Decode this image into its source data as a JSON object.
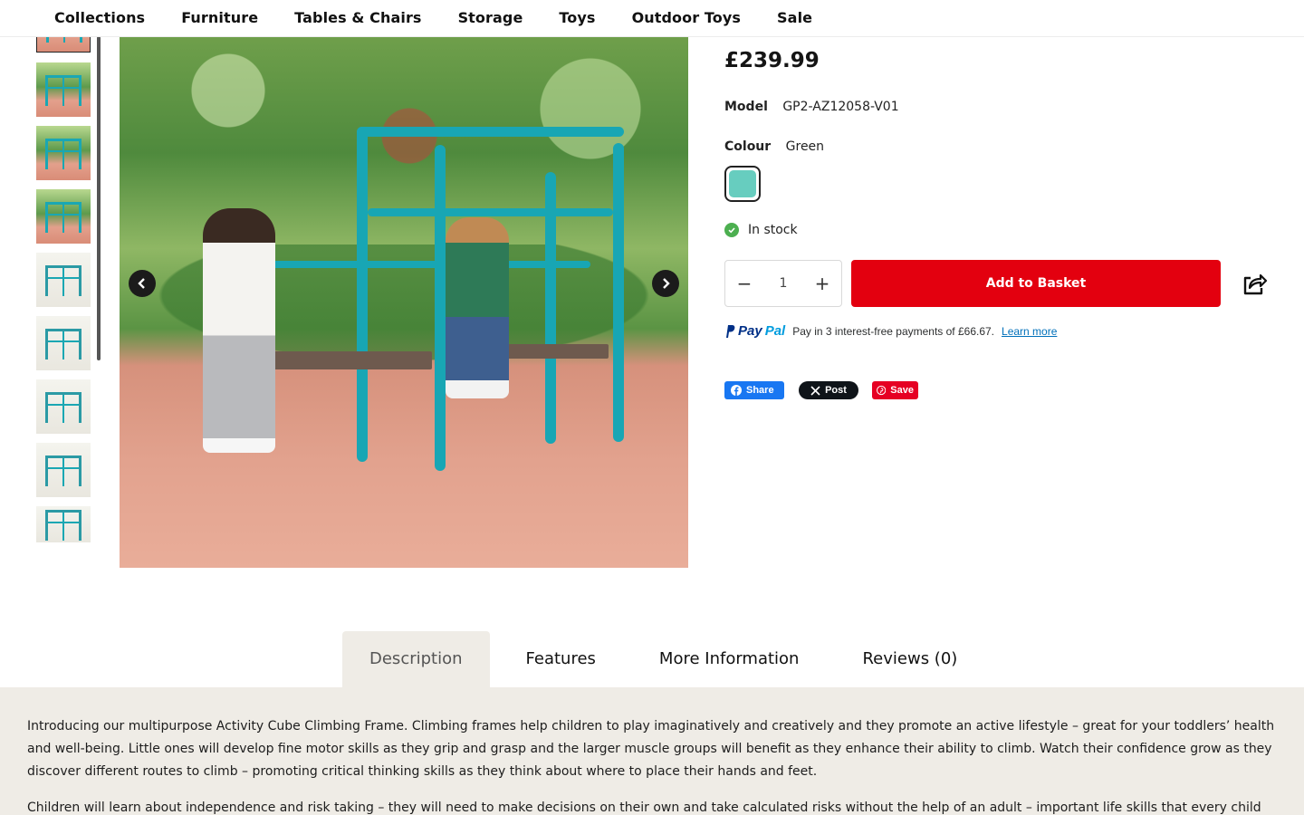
{
  "nav": {
    "items": [
      "Collections",
      "Furniture",
      "Tables & Chairs",
      "Storage",
      "Toys",
      "Outdoor Toys",
      "Sale"
    ]
  },
  "gallery": {
    "thumbnail_count": 9,
    "selected_index": 0
  },
  "product": {
    "price": "£239.99",
    "model_label": "Model",
    "model_value": "GP2-AZ12058-V01",
    "colour_label": "Colour",
    "colour_value": "Green",
    "swatch_color": "#67cdbf",
    "stock_text": "In stock",
    "stock_color": "#4caf50",
    "quantity": "1",
    "qty_minus": "−",
    "qty_plus": "+",
    "add_to_basket": "Add to Basket",
    "add_button_color": "#e3000f"
  },
  "paypal": {
    "logo_pay": "Pay",
    "logo_pal": "Pal",
    "message": "Pay in 3 interest-free payments of £66.67.",
    "link": "Learn more"
  },
  "social": {
    "facebook": "Share",
    "x": "Post",
    "pinterest": "Save"
  },
  "tabs": {
    "items": [
      "Description",
      "Features",
      "More Information",
      "Reviews (0)"
    ],
    "active_index": 0
  },
  "description": {
    "paragraph_1": "Introducing our multipurpose Activity Cube Climbing Frame. Climbing frames help children to play imaginatively and creatively and they promote an active lifestyle – great for your toddlers’ health and well-being. Little ones will develop fine motor skills as they grip and grasp and the larger muscle groups will benefit as they enhance their ability to climb. Watch their confidence grow as they discover different routes to climb – promoting critical thinking skills as they think about where to place their hands and feet.",
    "paragraph_2": "Children will learn about independence and risk taking – they will need to make decisions on their own and take calculated risks without the help of an adult – important life skills that every child will need as"
  }
}
